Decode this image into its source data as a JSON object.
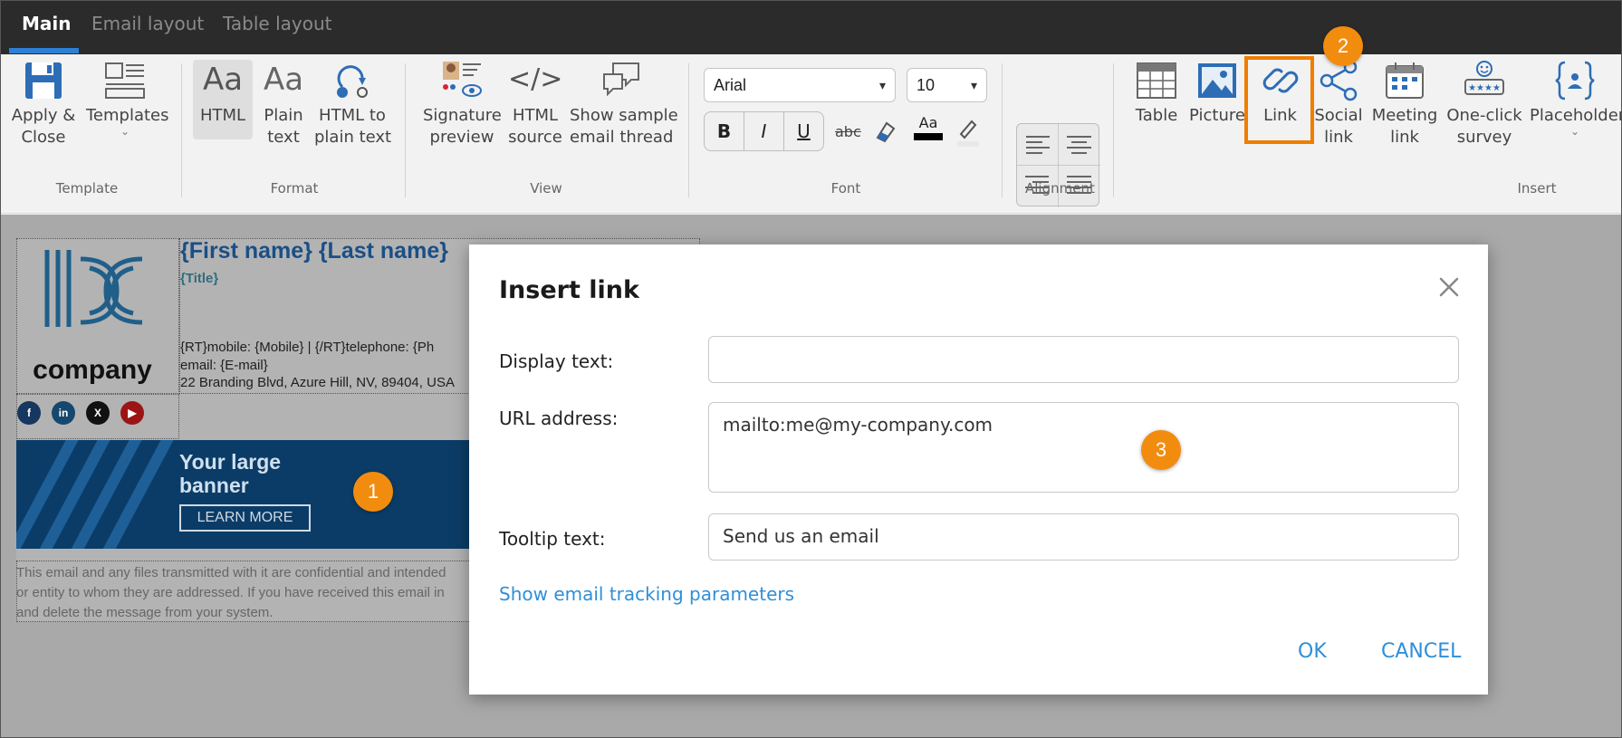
{
  "tabs": [
    {
      "label": "Main",
      "active": true
    },
    {
      "label": "Email layout",
      "active": false
    },
    {
      "label": "Table layout",
      "active": false
    }
  ],
  "ribbon": {
    "template": {
      "group": "Template",
      "apply_close": "Apply &\nClose",
      "templates": "Templates"
    },
    "format": {
      "group": "Format",
      "html": "HTML",
      "html_icon_text": "Aa",
      "plain_text": "Plain\ntext",
      "plain_icon_text": "Aa",
      "html_to_plain": "HTML to\nplain text"
    },
    "view": {
      "group": "View",
      "signature_preview": "Signature\npreview",
      "html_source": "HTML\nsource",
      "html_source_icon_text": "</>",
      "sample_thread": "Show sample\nemail thread"
    },
    "font": {
      "group": "Font",
      "family": "Arial",
      "size": "10",
      "bold": "B",
      "italic": "I",
      "underline": "U",
      "strikethrough": "abc",
      "font_color_icon_text": "Aa"
    },
    "alignment": {
      "group": "Alignment"
    },
    "insert": {
      "group": "Insert",
      "table": "Table",
      "picture": "Picture",
      "link": "Link",
      "social_link": "Social\nlink",
      "meeting_link": "Meeting\nlink",
      "one_click_survey": "One-click\nsurvey",
      "placeholder": "Placeholder"
    }
  },
  "callouts": {
    "one": "1",
    "two": "2",
    "three": "3"
  },
  "signature": {
    "logo_text": "company",
    "name": "{First name} {Last name}",
    "title": "{Title}",
    "line1": "{RT}mobile: {Mobile}  |  {/RT}telephone: {Ph",
    "line2": "email: {E-mail}",
    "line3": "22 Branding Blvd, Azure Hill, NV, 89404, USA",
    "social": [
      "f",
      "in",
      "X",
      "▶"
    ],
    "banner_title": "Your large\nbanner",
    "banner_button": "LEARN MORE",
    "disclaimer": "This email and any files transmitted with it are confidential and intended\nor entity to whom they are addressed. If you have received this email in\nand delete the message from your system."
  },
  "dialog": {
    "title": "Insert link",
    "display_text_label": "Display text:",
    "display_text_value": "",
    "url_label": "URL address:",
    "url_value": "mailto:me@my-company.com",
    "tooltip_label": "Tooltip text:",
    "tooltip_value": "Send us an email",
    "tracking_link": "Show email tracking parameters",
    "ok": "OK",
    "cancel": "CANCEL"
  },
  "colors": {
    "accent": "#2e7fd6",
    "callout": "#f28c0f",
    "highlight_border": "#f07d00",
    "dialog_link": "#2f8fd8"
  }
}
